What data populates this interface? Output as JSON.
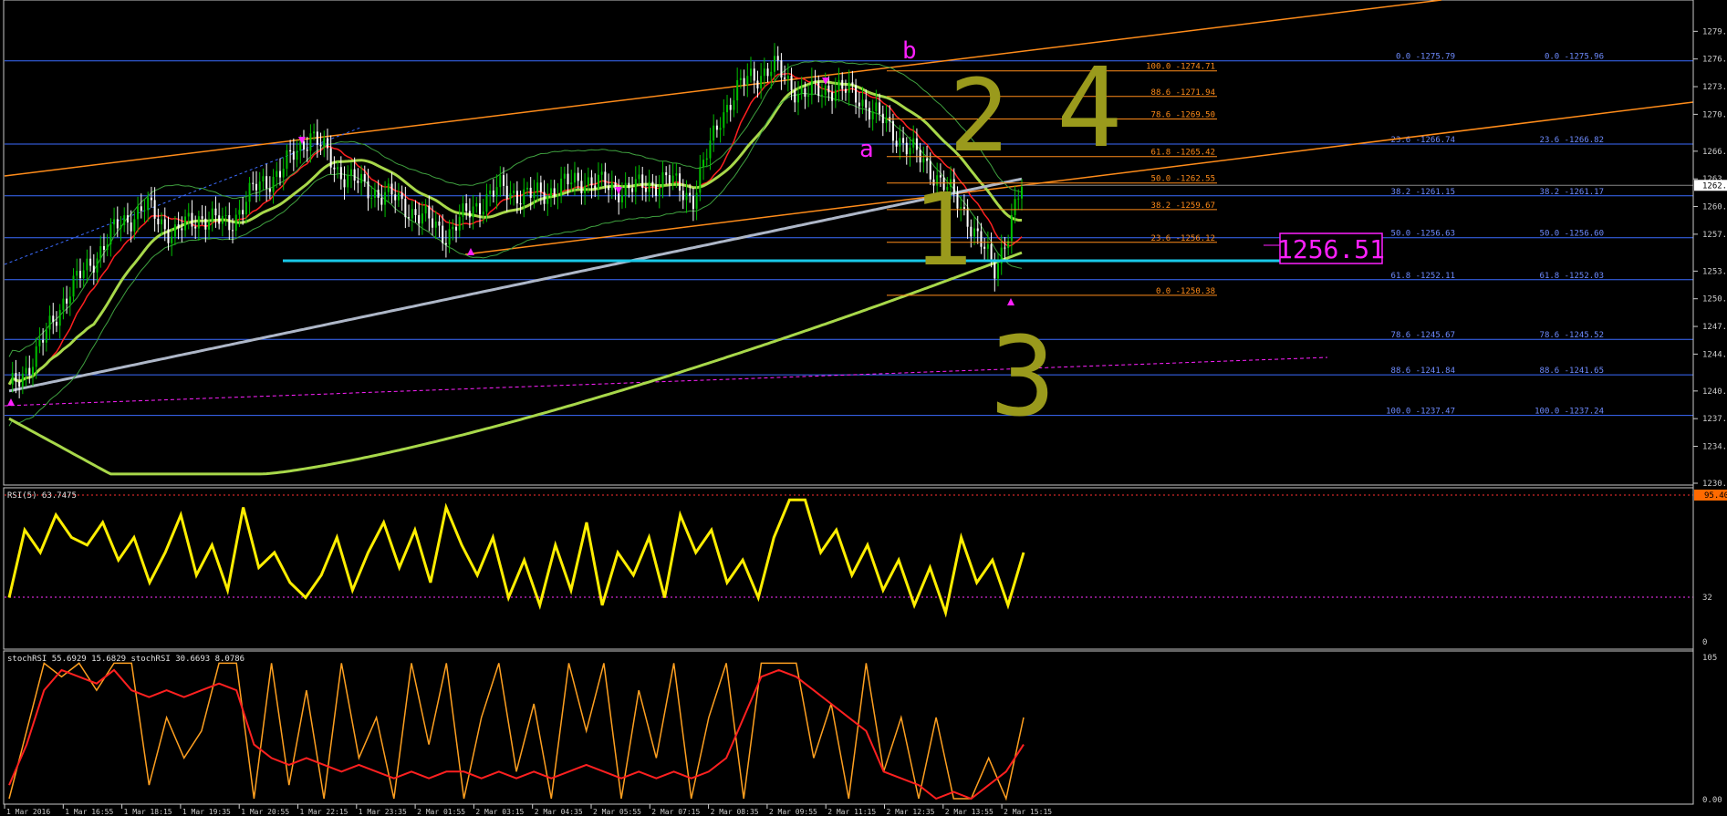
{
  "colors": {
    "background": "#000000",
    "panel_border": "#c8c8c8",
    "candle_bull": "#00c000",
    "candle_bear": "#ffffff",
    "blue_level": "#3b6cff",
    "orange": "#ff8c1a",
    "ma_red": "#ff2020",
    "ma_green": "#a8d84a",
    "bb_thin": "#3fa03f",
    "ma_grey": "#aeb7c8",
    "support_cyan": "#19c8e8",
    "magenta": "#ff20ff",
    "annot_olive": "#9a9a1c",
    "rsi_yellow": "#ffee00",
    "stoch_orange": "#ffa020",
    "stoch_red": "#ff2020"
  },
  "price_axis_ticks": [
    "1279.",
    "1276.",
    "1273.",
    "1270.",
    "1266.",
    "1263.",
    "1260.",
    "1257.",
    "1253.",
    "1250.",
    "1247.",
    "1244.",
    "1240.",
    "1237.",
    "1234.",
    "1230."
  ],
  "current_price_tag": "1262.",
  "price_callout": "1256.51",
  "wave_letters": [
    "b",
    "a"
  ],
  "wave_numbers": [
    "1",
    "2",
    "3",
    "4"
  ],
  "fib_orange": [
    {
      "label": "100.0 -1274.71",
      "price": 1274.71
    },
    {
      "label": "88.6 -1271.94",
      "price": 1271.94
    },
    {
      "label": "78.6 -1269.50",
      "price": 1269.5
    },
    {
      "label": "61.8 -1265.42",
      "price": 1265.42
    },
    {
      "label": "50.0 -1262.55",
      "price": 1262.55
    },
    {
      "label": "38.2 -1259.67",
      "price": 1259.67
    },
    {
      "label": "23.6 -1256.12",
      "price": 1256.12
    },
    {
      "label": "0.0 -1250.38",
      "price": 1250.38
    }
  ],
  "fib_blue": [
    {
      "left": "0.0 -1275.79",
      "right": "0.0 -1275.96",
      "price": 1275.8
    },
    {
      "left": "23.6 -1266.74",
      "right": "23.6 -1266.82",
      "price": 1266.78
    },
    {
      "left": "38.2 -1261.15",
      "right": "38.2 -1261.17",
      "price": 1261.16
    },
    {
      "left": "50.0 -1256.63",
      "right": "50.0 -1256.60",
      "price": 1256.62
    },
    {
      "left": "61.8 -1252.11",
      "right": "61.8 -1252.03",
      "price": 1252.07
    },
    {
      "left": "78.6 -1245.67",
      "right": "78.6 -1245.52",
      "price": 1245.6
    },
    {
      "left": "88.6 -1241.84",
      "right": "88.6 -1241.65",
      "price": 1241.75
    },
    {
      "left": "100.0 -1237.47",
      "right": "100.0 -1237.24",
      "price": 1237.35
    }
  ],
  "rsi_panel": {
    "label": "RSI(5) 63.7475",
    "axis_ticks": [
      "32",
      "0"
    ],
    "upper_tag": "95.40"
  },
  "stoch_panel": {
    "label": "stochRSI 55.6929 15.6829  stochRSI 30.6693 8.0786",
    "axis_ticks": [
      "105",
      "0.00"
    ]
  },
  "time_axis_labels": [
    "1 Mar 2016",
    "1 Mar 16:55",
    "1 Mar 18:15",
    "1 Mar 19:35",
    "1 Mar 20:55",
    "1 Mar 22:15",
    "1 Mar 23:35",
    "2 Mar 01:55",
    "2 Mar 03:15",
    "2 Mar 04:35",
    "2 Mar 05:55",
    "2 Mar 07:15",
    "2 Mar 08:35",
    "2 Mar 09:55",
    "2 Mar 11:15",
    "2 Mar 12:35",
    "2 Mar 13:55",
    "2 Mar 15:15"
  ],
  "chart_data": [
    {
      "type": "line",
      "description_panel": "main price",
      "ylim": [
        1230,
        1282
      ],
      "x_labels": [
        "1 Mar 2016",
        "1 Mar 16:55",
        "1 Mar 18:15",
        "1 Mar 19:35",
        "1 Mar 20:55",
        "1 Mar 22:15",
        "1 Mar 23:35",
        "2 Mar 01:55",
        "2 Mar 03:15",
        "2 Mar 04:35",
        "2 Mar 05:55",
        "2 Mar 07:15",
        "2 Mar 08:35",
        "2 Mar 09:55",
        "2 Mar 11:15",
        "2 Mar 12:35",
        "2 Mar 13:55",
        "2 Mar 15:15"
      ],
      "series": [
        {
          "values": [
            1240,
            1244,
            1250,
            1254,
            1258,
            1260,
            1257,
            1259,
            1258,
            1262,
            1264,
            1268,
            1264,
            1262,
            1261,
            1259,
            1257,
            1260,
            1262,
            1261,
            1262,
            1263,
            1262,
            1262,
            1263,
            1261,
            1270,
            1274,
            1275,
            1272,
            1273,
            1272,
            1269,
            1266,
            1263,
            1259,
            1253,
            1262
          ]
        }
      ]
    },
    {
      "type": "line",
      "description_panel": "RSI",
      "ylim": [
        0,
        100
      ],
      "series": [
        {
          "values": [
            30,
            75,
            60,
            85,
            70,
            65,
            80,
            55,
            70,
            40,
            60,
            85,
            45,
            65,
            35,
            90,
            50,
            60,
            40,
            30,
            45,
            70,
            35,
            60,
            80,
            50,
            75,
            40,
            90,
            65,
            45,
            70,
            30,
            55,
            25,
            65,
            35,
            80,
            25,
            60,
            45,
            70,
            30,
            85,
            60,
            75,
            40,
            55,
            30,
            70,
            95,
            95,
            60,
            75,
            45,
            65,
            35,
            55,
            25,
            50,
            20,
            70,
            40,
            55,
            25,
            60
          ]
        }
      ]
    },
    {
      "type": "line",
      "description_panel": "stochRSI",
      "ylim": [
        0,
        105
      ],
      "series": [
        {
          "values": [
            0,
            50,
            100,
            90,
            100,
            80,
            100,
            100,
            10,
            60,
            30,
            50,
            100,
            100,
            0,
            100,
            10,
            80,
            0,
            100,
            30,
            60,
            0,
            100,
            40,
            100,
            0,
            60,
            100,
            20,
            70,
            0,
            100,
            50,
            100,
            0,
            80,
            30,
            100,
            0,
            60,
            100,
            0,
            100,
            100,
            100,
            30,
            70,
            0,
            100,
            20,
            60,
            0,
            60,
            0,
            0,
            30,
            0,
            60
          ]
        },
        {
          "values": [
            10,
            40,
            80,
            95,
            90,
            85,
            95,
            80,
            75,
            80,
            75,
            80,
            85,
            80,
            40,
            30,
            25,
            30,
            25,
            20,
            25,
            20,
            15,
            20,
            15,
            20,
            20,
            15,
            20,
            15,
            20,
            15,
            20,
            25,
            20,
            15,
            20,
            15,
            20,
            15,
            20,
            30,
            60,
            90,
            95,
            90,
            80,
            70,
            60,
            50,
            20,
            15,
            10,
            0,
            5,
            0,
            10,
            20,
            40
          ]
        }
      ]
    }
  ]
}
